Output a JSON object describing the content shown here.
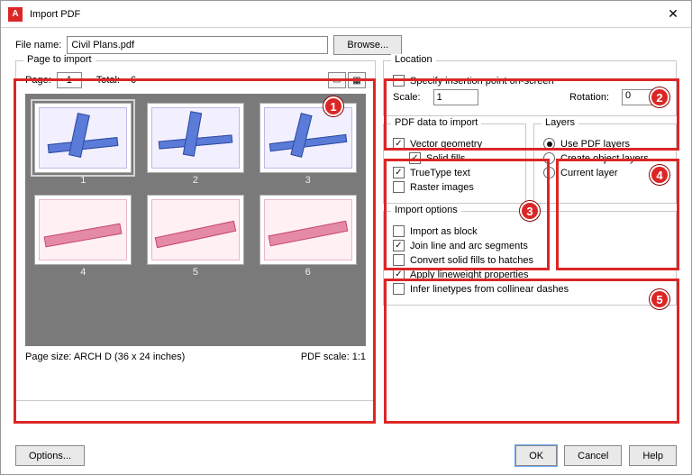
{
  "window": {
    "title": "Import PDF"
  },
  "file": {
    "label": "File name:",
    "value": "Civil Plans.pdf",
    "browse": "Browse..."
  },
  "page_to_import": {
    "legend": "Page to import",
    "page_label": "Page:",
    "page_value": "1",
    "total_label": "Total:",
    "total_value": "6",
    "thumbs": [
      "1",
      "2",
      "3",
      "4",
      "5",
      "6"
    ],
    "size_label": "Page size:",
    "size_value": "ARCH D (36 x 24 inches)",
    "scale_label": "PDF scale:",
    "scale_value": "1:1"
  },
  "location": {
    "legend": "Location",
    "specify": "Specify insertion point on-screen",
    "scale_label": "Scale:",
    "scale_value": "1",
    "rotation_label": "Rotation:",
    "rotation_value": "0"
  },
  "pdf_data": {
    "legend": "PDF data to import",
    "vector": "Vector geometry",
    "solid": "Solid fills",
    "truetype": "TrueType text",
    "raster": "Raster images"
  },
  "layers": {
    "legend": "Layers",
    "use_pdf": "Use PDF layers",
    "create": "Create object layers",
    "current": "Current layer"
  },
  "import_opts": {
    "legend": "Import options",
    "block": "Import as block",
    "join": "Join line and arc segments",
    "hatch": "Convert solid fills to hatches",
    "lineweight": "Apply lineweight properties",
    "linetypes": "Infer linetypes from collinear dashes"
  },
  "buttons": {
    "options": "Options...",
    "ok": "OK",
    "cancel": "Cancel",
    "help": "Help"
  },
  "badges": {
    "b1": "1",
    "b2": "2",
    "b3": "3",
    "b4": "4",
    "b5": "5"
  }
}
